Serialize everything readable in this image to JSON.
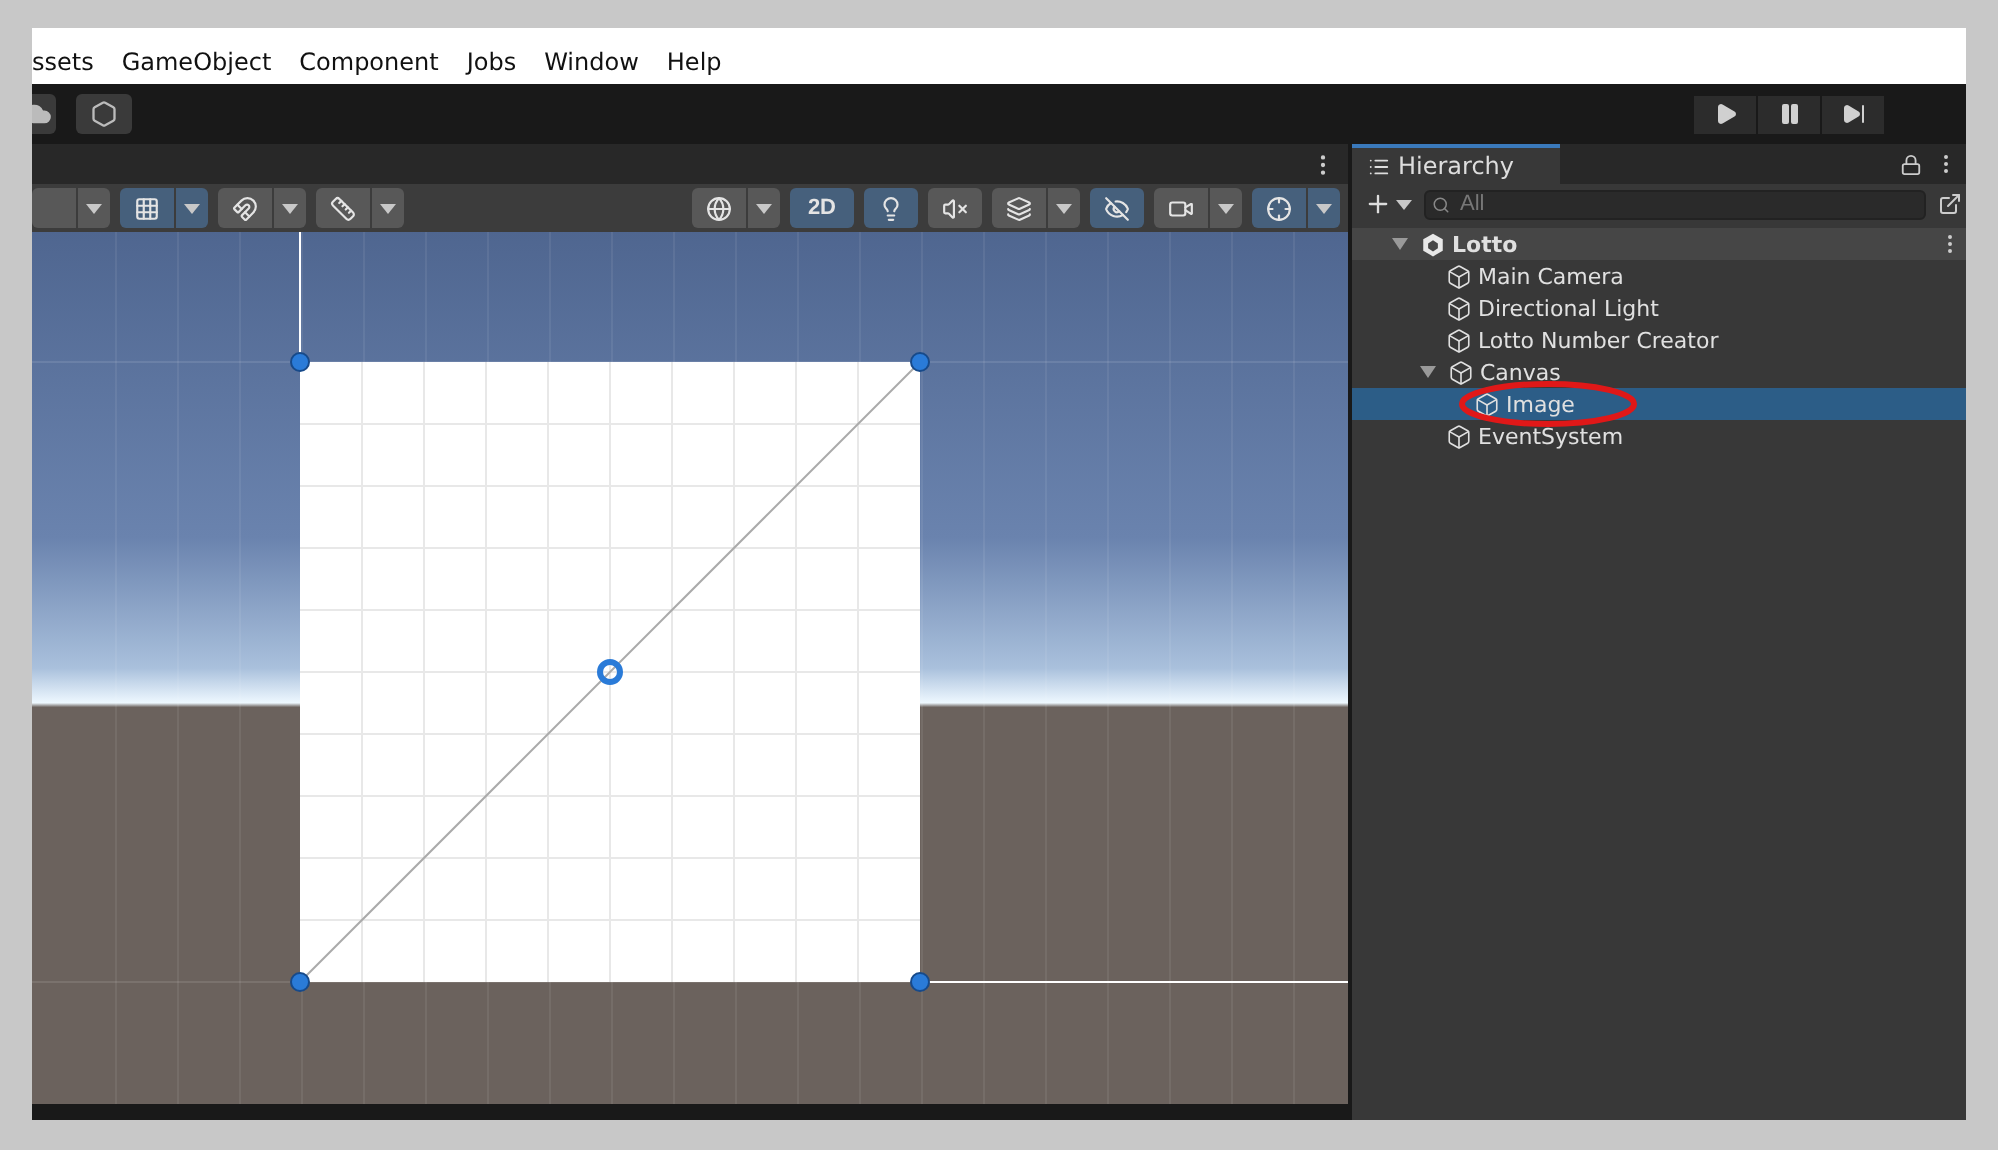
{
  "menu": [
    "ssets",
    "GameObject",
    "Component",
    "Jobs",
    "Window",
    "Help"
  ],
  "play_controls": [
    {
      "kind": "play",
      "selected": false
    },
    {
      "kind": "pause",
      "selected": false
    },
    {
      "kind": "step",
      "selected": false
    }
  ],
  "scene_toolbar_left": [
    {
      "kind": "dropdown",
      "selected": false
    },
    {
      "kind": "dropdown",
      "selected": true
    },
    {
      "kind": "dropdown",
      "selected": false
    },
    {
      "kind": "dropdown",
      "selected": false
    }
  ],
  "scene_toolbar_right": [
    {
      "kind": "dropdown",
      "selected": false
    },
    {
      "kind": "toggle",
      "label": "2D",
      "selected": true
    },
    {
      "kind": "toggle",
      "selected": true
    },
    {
      "kind": "toggle",
      "selected": false
    },
    {
      "kind": "dropdown",
      "selected": false
    },
    {
      "kind": "toggle",
      "selected": true
    },
    {
      "kind": "dropdown",
      "selected": false
    },
    {
      "kind": "dropdown",
      "selected": true
    }
  ],
  "hierarchy": {
    "tab": "Hierarchy",
    "search": {
      "placeholder": "All"
    },
    "tree": [
      {
        "kind": "scene",
        "label": "Lotto",
        "expanded": true,
        "selected": false,
        "children": [
          {
            "kind": "object",
            "label": "Main Camera",
            "selected": false
          },
          {
            "kind": "object",
            "label": "Directional Light",
            "selected": false
          },
          {
            "kind": "object",
            "label": "Lotto Number Creator",
            "selected": false
          },
          {
            "kind": "object",
            "label": "Canvas",
            "expanded": true,
            "selected": false,
            "children": [
              {
                "kind": "object",
                "label": "Image",
                "selected": true,
                "annotated": true
              }
            ]
          },
          {
            "kind": "object",
            "label": "EventSystem",
            "selected": false
          }
        ]
      }
    ]
  }
}
